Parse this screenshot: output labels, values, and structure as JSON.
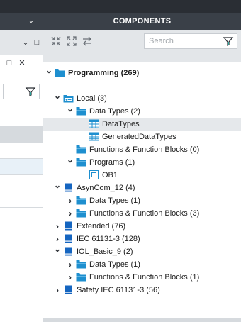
{
  "left_panel": {
    "icons": [
      "chevron-down-icon",
      "chevron-down-icon",
      "maximize-icon",
      "close-icon",
      "filter-icon"
    ]
  },
  "components": {
    "title": "COMPONENTS",
    "toolbar": {
      "icons": [
        "collapse-all-icon",
        "expand-all-icon",
        "sync-icon"
      ]
    },
    "search": {
      "placeholder": "Search",
      "value": ""
    },
    "tree": [
      {
        "id": "programming",
        "label": "Programming (269)",
        "level": 0,
        "caret": "down",
        "icon": "folder-icon",
        "bold": true
      },
      {
        "id": "local",
        "label": "Local (3)",
        "level": 1,
        "caret": "down",
        "icon": "local-library-icon"
      },
      {
        "id": "local-datatypes",
        "label": "Data Types (2)",
        "level": 2,
        "caret": "down",
        "icon": "folder-icon"
      },
      {
        "id": "datatypes",
        "label": "DataTypes",
        "level": 3,
        "caret": "none",
        "icon": "datatype-table-icon",
        "selected": true
      },
      {
        "id": "generated",
        "label": "GeneratedDataTypes",
        "level": 3,
        "caret": "none",
        "icon": "datatype-table-icon"
      },
      {
        "id": "local-fb",
        "label": "Functions & Function Blocks (0)",
        "level": 2,
        "caret": "none",
        "icon": "folder-icon"
      },
      {
        "id": "programs",
        "label": "Programs (1)",
        "level": 2,
        "caret": "down",
        "icon": "folder-icon"
      },
      {
        "id": "ob1",
        "label": "OB1",
        "level": 3,
        "caret": "none",
        "icon": "program-block-icon"
      },
      {
        "id": "asyncom",
        "label": "AsynCom_12 (4)",
        "level": 1,
        "caret": "down",
        "icon": "library-icon"
      },
      {
        "id": "asyn-dt",
        "label": "Data Types (1)",
        "level": 2,
        "caret": "right",
        "icon": "folder-icon"
      },
      {
        "id": "asyn-fb",
        "label": "Functions & Function Blocks (3)",
        "level": 2,
        "caret": "right",
        "icon": "folder-icon"
      },
      {
        "id": "extended",
        "label": "Extended (76)",
        "level": 1,
        "caret": "right",
        "icon": "library-icon"
      },
      {
        "id": "iec",
        "label": "IEC 61131-3 (128)",
        "level": 1,
        "caret": "right",
        "icon": "library-icon"
      },
      {
        "id": "iol",
        "label": "IOL_Basic_9 (2)",
        "level": 1,
        "caret": "down",
        "icon": "library-icon"
      },
      {
        "id": "iol-dt",
        "label": "Data Types (1)",
        "level": 2,
        "caret": "right",
        "icon": "folder-icon"
      },
      {
        "id": "iol-fb",
        "label": "Functions & Function Blocks (1)",
        "level": 2,
        "caret": "right",
        "icon": "folder-icon"
      },
      {
        "id": "safety",
        "label": "Safety IEC 61131-3 (56)",
        "level": 1,
        "caret": "right",
        "icon": "library-icon"
      }
    ]
  },
  "colors": {
    "header_bg": "#3a4048",
    "folder_blue": "#1e8fcf",
    "library_blue": "#1565c0",
    "selected_row": "#e5e8eb"
  }
}
